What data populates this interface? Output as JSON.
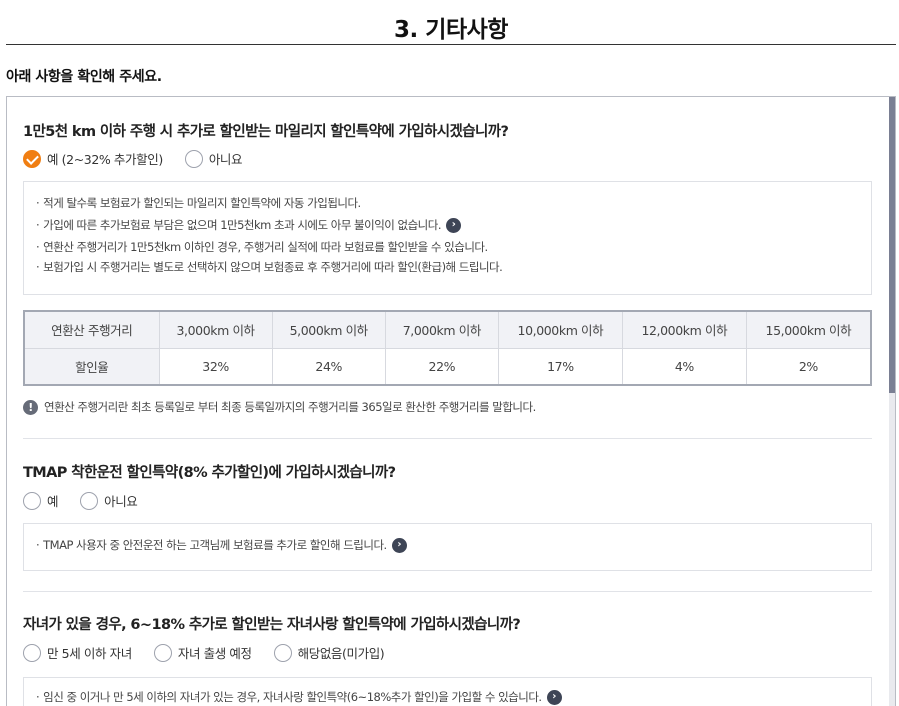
{
  "header": {
    "title": "3. 기타사항",
    "intro": "아래 사항을 확인해 주세요."
  },
  "section1": {
    "question": "1만5천 km 이하 주행 시 추가로 할인받는 마일리지 할인특약에 가입하시겠습니까?",
    "options": [
      {
        "label": "예 (2~32% 추가할인)",
        "selected": true
      },
      {
        "label": "아니요",
        "selected": false
      }
    ],
    "bullets": [
      "적게 탈수록 보험료가 할인되는 마일리지 할인특약에 자동 가입됩니다.",
      "가입에 따른 추가보험료 부담은 없으며 1만5천km 초과 시에도 아무 불이익이 없습니다.",
      "연환산 주행거리가 1만5천km 이하인 경우, 주행거리 실적에 따라 보험료를 할인받을 수 있습니다.",
      "보험가입 시 주행거리는 별도로 선택하지 않으며 보험종료 후 주행거리에 따라 할인(환급)해 드립니다."
    ],
    "table": {
      "row1_head": "연환산 주행거리",
      "row2_head": "할인율",
      "distances": [
        "3,000km 이하",
        "5,000km 이하",
        "7,000km 이하",
        "10,000km 이하",
        "12,000km 이하",
        "15,000km 이하"
      ],
      "rates": [
        "32%",
        "24%",
        "22%",
        "17%",
        "4%",
        "2%"
      ]
    },
    "notice": "연환산 주행거리란 최초 등록일로 부터 최종 등록일까지의 주행거리를 365일로 환산한 주행거리를 말합니다."
  },
  "section2": {
    "question": "TMAP 착한운전 할인특약(8% 추가할인)에 가입하시겠습니까?",
    "options": [
      {
        "label": "예",
        "selected": false
      },
      {
        "label": "아니요",
        "selected": false
      }
    ],
    "bullets": [
      "TMAP 사용자 중 안전운전 하는 고객님께 보험료를 추가로 할인해 드립니다."
    ]
  },
  "section3": {
    "question": "자녀가 있을 경우, 6~18% 추가로 할인받는 자녀사랑 할인특약에 가입하시겠습니까?",
    "options": [
      {
        "label": "만 5세 이하 자녀",
        "selected": false
      },
      {
        "label": "자녀 출생 예정",
        "selected": false
      },
      {
        "label": "해당없음(미가입)",
        "selected": false
      }
    ],
    "bullets": [
      "임신 중 이거나 만 5세 이하의 자녀가 있는 경우, 자녀사랑 할인특약(6~18%추가 할인)을 가입할 수 있습니다."
    ]
  },
  "icons": {
    "more": "chevron-right-circle-icon",
    "notice": "exclamation-circle-icon",
    "check": "check-icon"
  },
  "colors": {
    "accent": "#f07e12",
    "icon_dark": "#3e4556"
  }
}
